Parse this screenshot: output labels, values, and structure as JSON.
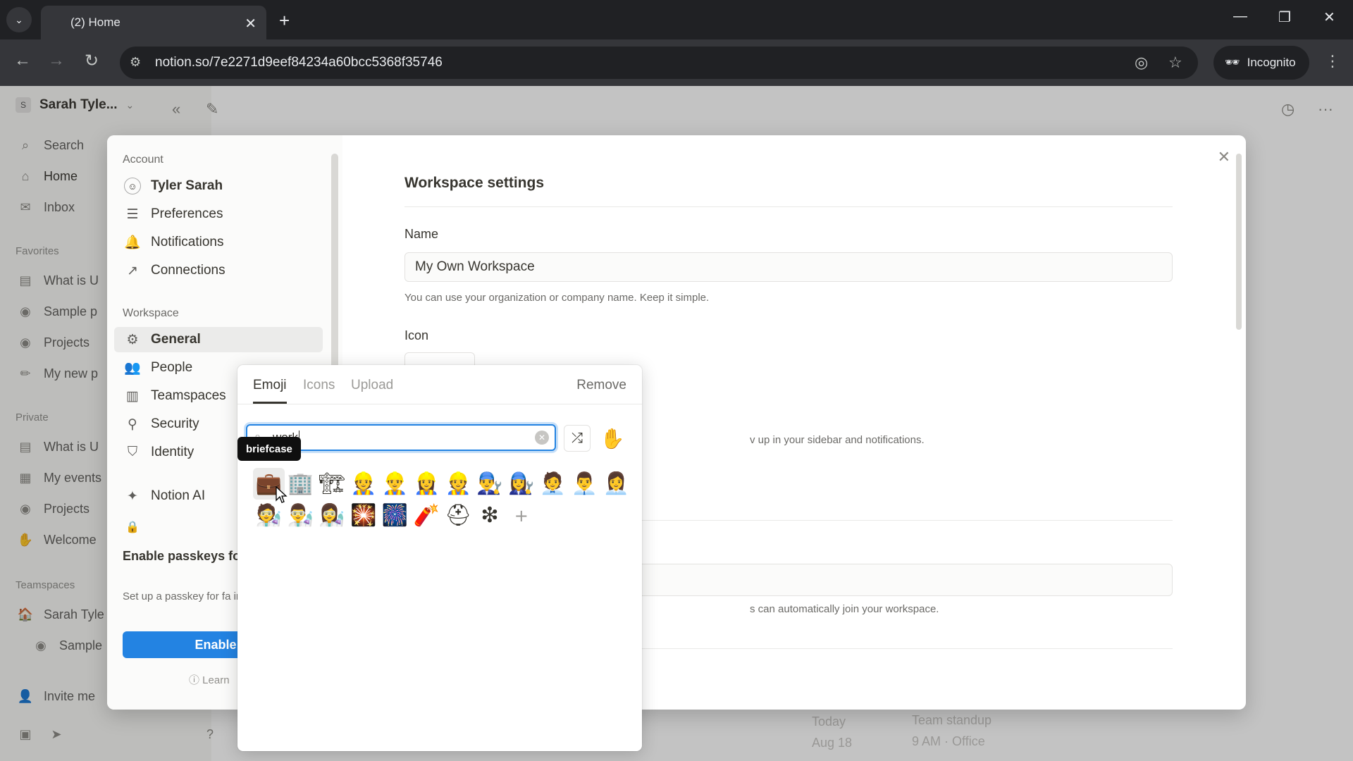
{
  "browser": {
    "tab_title": "(2) Home",
    "url": "notion.so/7e2271d9eef84234a60bcc5368f35746",
    "incognito_label": "Incognito"
  },
  "sidebar": {
    "workspace_name": "Sarah Tyle...",
    "workspace_initial": "S",
    "top_items": [
      {
        "label": "Search",
        "icon": "search-icon"
      },
      {
        "label": "Home",
        "icon": "home-icon"
      },
      {
        "label": "Inbox",
        "icon": "inbox-icon"
      }
    ],
    "favorites_label": "Favorites",
    "favorites": [
      "What is U",
      "Sample p",
      "Projects",
      "My new p"
    ],
    "private_label": "Private",
    "private": [
      "What is U",
      "My events",
      "Projects",
      "Welcome"
    ],
    "teamspaces_label": "Teamspaces",
    "teamspaces": [
      "Sarah Tyle",
      "Sample"
    ],
    "invite_label": "Invite me"
  },
  "background": {
    "today": "Today",
    "aug": "Aug 18",
    "event_title": "Team standup",
    "event_sub": "9 AM · Office"
  },
  "settings_nav": {
    "account_label": "Account",
    "account_items": [
      {
        "label": "Tyler Sarah",
        "icon": "avatar-icon"
      },
      {
        "label": "Preferences",
        "icon": "sliders-icon"
      },
      {
        "label": "Notifications",
        "icon": "bell-icon"
      },
      {
        "label": "Connections",
        "icon": "external-link-icon"
      }
    ],
    "workspace_label": "Workspace",
    "workspace_items": [
      {
        "label": "General",
        "icon": "gear-icon"
      },
      {
        "label": "People",
        "icon": "people-icon"
      },
      {
        "label": "Teamspaces",
        "icon": "building-icon"
      },
      {
        "label": "Security",
        "icon": "key-icon"
      },
      {
        "label": "Identity",
        "icon": "shield-check-icon"
      }
    ],
    "notion_ai": "Notion AI",
    "passkey_title": "Enable passkeys fo protection",
    "passkey_sub": "Set up a passkey for fa ins.",
    "passkey_button": "Enable pa",
    "learn": "Learn"
  },
  "settings_content": {
    "title": "Workspace settings",
    "name_label": "Name",
    "name_value": "My Own Workspace",
    "name_help": "You can use your organization or company name. Keep it simple.",
    "icon_label": "Icon",
    "icon_help_partial": "v up in your sidebar and notifications.",
    "domain_help_partial": "s can automatically join your workspace."
  },
  "emoji_picker": {
    "tabs": [
      "Emoji",
      "Icons",
      "Upload"
    ],
    "remove_label": "Remove",
    "search_value": "work",
    "tooltip": "briefcase",
    "emojis": [
      "💼",
      "🏢",
      "🏗",
      "👷",
      "👷‍♂️",
      "👷‍♀️",
      "👷",
      "👨‍🔧",
      "👩‍🔧",
      "🧑‍💼",
      "👨‍💼",
      "👩‍💼",
      "🧑‍🔬",
      "👨‍🔬",
      "👩‍🔬",
      "🎇",
      "🎆",
      "🧨",
      "⛑",
      "❇"
    ]
  }
}
